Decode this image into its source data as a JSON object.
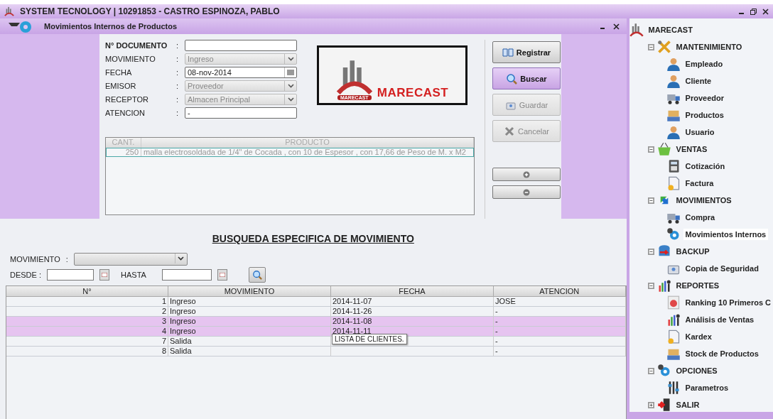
{
  "window": {
    "title": "SYSTEM TECNOLOGY | 10291853 - CASTRO ESPINOZA, PABLO"
  },
  "frame": {
    "title": "Movimientos Internos de Productos"
  },
  "form": {
    "fields": [
      {
        "label": "N° DOCUMENTO",
        "kind": "text",
        "emphasized": true,
        "disabled": false
      },
      {
        "label": "MOVIMIENTO",
        "kind": "combo",
        "value": "Ingreso",
        "emphasized": false,
        "disabled": true
      },
      {
        "label": "FECHA",
        "kind": "date",
        "value": "08-nov-2014",
        "emphasized": false,
        "disabled": false
      },
      {
        "label": "EMISOR",
        "kind": "combo",
        "value": "Proveedor",
        "emphasized": false,
        "disabled": true
      },
      {
        "label": "RECEPTOR",
        "kind": "combo",
        "value": "Almacen Principal",
        "emphasized": false,
        "disabled": true
      },
      {
        "label": "ATENCION",
        "kind": "text",
        "value": "-",
        "emphasized": false,
        "disabled": false
      }
    ],
    "separator": ":"
  },
  "logo": {
    "name": "MARECAST",
    "small": "MARECAST"
  },
  "buttons": [
    {
      "label": "Registrar",
      "selected": false,
      "disabled": false
    },
    {
      "label": "Buscar",
      "selected": true,
      "disabled": false
    },
    {
      "label": "Guardar",
      "selected": false,
      "disabled": true
    },
    {
      "label": "Cancelar",
      "selected": false,
      "disabled": true
    }
  ],
  "products": {
    "columns": [
      "CANT.",
      "PRODUCTO"
    ],
    "rows": [
      {
        "cant": "250",
        "producto": "malla electrosoldada de 1/4\" de Cocada , con 10 de Espesor , con 17,66 de Peso  de M. x M2",
        "selected": true
      }
    ]
  },
  "search": {
    "heading": "BUSQUEDA ESPECIFICA DE MOVIMIENTO",
    "movimiento_label": "MOVIMIENTO",
    "separator": ":",
    "desde_label": "DESDE :",
    "hasta_label": "HASTA"
  },
  "results": {
    "columns": [
      "N°",
      "MOVIMIENTO",
      "FECHA",
      "ATENCION"
    ],
    "rows": [
      {
        "n": "1",
        "movimiento": "Ingreso",
        "fecha": "2014-11-07",
        "atencion": "JOSE",
        "selected": false
      },
      {
        "n": "2",
        "movimiento": "Ingreso",
        "fecha": "2014-11-26",
        "atencion": "-",
        "selected": false
      },
      {
        "n": "3",
        "movimiento": "Ingreso",
        "fecha": "2014-11-08",
        "atencion": "-",
        "selected": true
      },
      {
        "n": "4",
        "movimiento": "Ingreso",
        "fecha": "2014-11-11",
        "atencion": "-",
        "selected": true
      },
      {
        "n": "7",
        "movimiento": "Salida",
        "atencion": "-",
        "selected": false
      },
      {
        "n": "8",
        "movimiento": "Salida",
        "atencion": "-",
        "selected": false
      }
    ],
    "tooltip": "LISTA DE CLIENTES."
  },
  "tree": {
    "label": "MARECAST",
    "children": [
      {
        "label": "MANTENIMIENTO",
        "expanded": true,
        "children": [
          {
            "label": "Empleado",
            "selected": false
          },
          {
            "label": "Cliente",
            "selected": false
          },
          {
            "label": "Proveedor",
            "selected": false
          },
          {
            "label": "Productos",
            "selected": false
          },
          {
            "label": "Usuario",
            "selected": false
          }
        ]
      },
      {
        "label": "VENTAS",
        "expanded": true,
        "children": [
          {
            "label": "Cotización",
            "selected": false
          },
          {
            "label": "Factura",
            "selected": false
          }
        ]
      },
      {
        "label": "MOVIMIENTOS",
        "expanded": true,
        "children": [
          {
            "label": "Compra",
            "selected": false
          },
          {
            "label": "Movimientos Internos",
            "selected": true
          }
        ]
      },
      {
        "label": "BACKUP",
        "expanded": true,
        "children": [
          {
            "label": "Copia de Seguridad",
            "selected": false
          }
        ]
      },
      {
        "label": "REPORTES",
        "expanded": true,
        "children": [
          {
            "label": "Ranking 10 Primeros C",
            "selected": false
          },
          {
            "label": "Análisis de Ventas",
            "selected": false
          },
          {
            "label": "Kardex",
            "selected": false
          },
          {
            "label": "Stock de Productos",
            "selected": false
          }
        ]
      },
      {
        "label": "OPCIONES",
        "expanded": true,
        "children": [
          {
            "label": "Parametros",
            "selected": false
          }
        ]
      },
      {
        "label": "SALIR",
        "expanded": false
      }
    ]
  }
}
